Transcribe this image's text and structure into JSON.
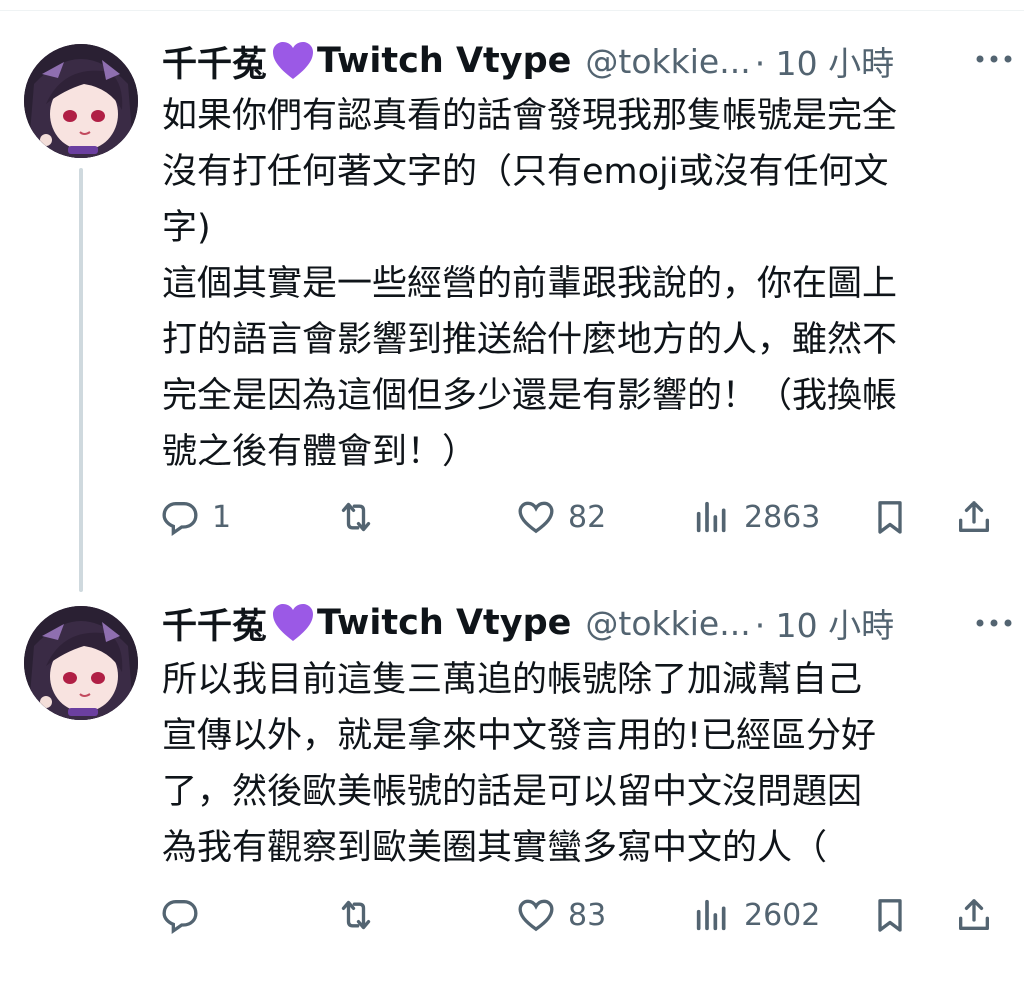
{
  "tweets": [
    {
      "name": "千千菟",
      "name_suffix": "Twitch Vtype",
      "handle": "@tokkie...",
      "time": "· 10 小時",
      "text": "如果你們有認真看的話會發現我那隻帳號是完全\n沒有打任何著文字的（只有emoji或沒有任何文\n字)\n這個其實是一些經營的前輩跟我說的，你在圖上\n打的語言會影響到推送給什麼地方的人，雖然不\n完全是因為這個但多少還是有影響的！（我換帳\n號之後有體會到！）",
      "replies": "1",
      "retweets": "",
      "likes": "82",
      "views": "2863"
    },
    {
      "name": "千千菟",
      "name_suffix": "Twitch Vtype",
      "handle": "@tokkie...",
      "time": "· 10 小時",
      "text": "所以我目前這隻三萬追的帳號除了加減幫自己\n宣傳以外，就是拿來中文發言用的!已經區分好\n了，然後歐美帳號的話是可以留中文沒問題因\n為我有觀察到歐美圈其實蠻多寫中文的人（",
      "replies": "",
      "retweets": "",
      "likes": "83",
      "views": "2602"
    }
  ],
  "icons": {
    "heart_emoji": "purple-heart-icon",
    "reply": "reply-icon",
    "retweet": "retweet-icon",
    "like": "like-icon",
    "views": "views-icon",
    "bookmark": "bookmark-icon",
    "share": "share-icon",
    "more": "more-icon"
  },
  "colors": {
    "text": "#0f1419",
    "secondary": "#536471",
    "thread_line": "#cfd9de",
    "purple_heart": "#9b59e6"
  }
}
